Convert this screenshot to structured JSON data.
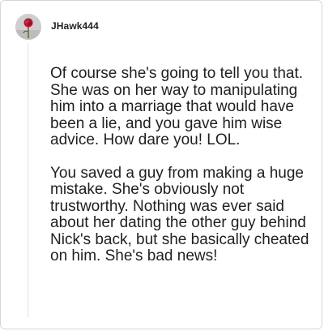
{
  "comment": {
    "username": "JHawk444",
    "avatar_icon": "rose-avatar-icon",
    "paragraphs": [
      "Of course she's going to tell you that. She was on her way to manipulating him into a marriage that would have been a lie, and you gave him wise advice. How dare you! LOL.",
      "You saved a guy from making a huge mistake. She's obviously not trustworthy. Nothing was ever said about her dating the other guy behind Nick's back, but she basically cheated on him. She's bad news!"
    ]
  },
  "colors": {
    "border": "#d6d6d6",
    "text": "#1f1f1f",
    "thread_line": "#e2e2e2",
    "avatar_bg": "#d9d9d9",
    "rose": "#b3162b"
  }
}
